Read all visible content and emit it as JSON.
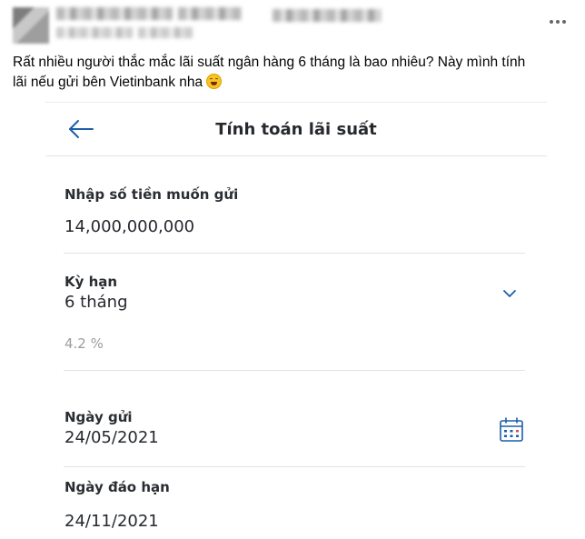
{
  "post": {
    "text_line1": "Rất nhiều người thắc mắc lãi suất ngân hàng 6 tháng là bao nhiêu? Này mình tính",
    "text_line2": "lãi nếu gửi bên Vietinbank nha",
    "emoji": "grinning-sweat-emoji",
    "more_icon": "more-horizontal-icon"
  },
  "app": {
    "title": "Tính toán lãi suất",
    "back_icon": "arrow-left-icon",
    "amount": {
      "label": "Nhập số tiền muốn gửi",
      "value": "14,000,000,000"
    },
    "term": {
      "label": "Kỳ hạn",
      "value": "6 tháng",
      "rate": "4.2 %",
      "icon": "chevron-down-icon"
    },
    "deposit_date": {
      "label": "Ngày gửi",
      "value": "24/05/2021",
      "icon": "calendar-icon"
    },
    "maturity_date": {
      "label": "Ngày đáo hạn",
      "value": "24/11/2021"
    },
    "colors": {
      "accent": "#1a5fa8",
      "text": "#26292e",
      "muted": "#9a9da1",
      "divider": "#e3e3e3"
    }
  }
}
